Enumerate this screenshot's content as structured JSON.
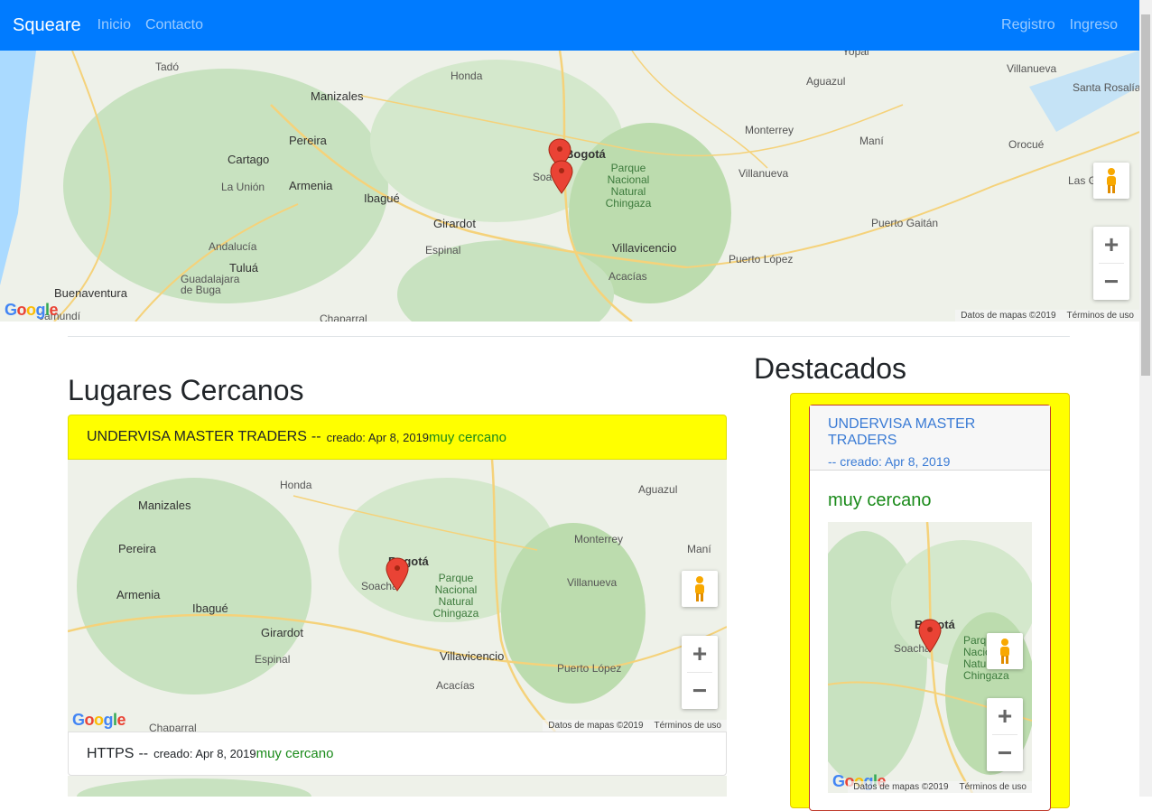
{
  "navbar": {
    "brand": "Squeare",
    "links": [
      "Inicio",
      "Contacto"
    ],
    "right_links": [
      "Registro",
      "Ingreso"
    ],
    "background": "#007bff"
  },
  "map_common": {
    "attribution": "Datos de mapas ©2019",
    "terms": "Términos de uso",
    "logo": "Google",
    "zoom_in": "+",
    "zoom_out": "−"
  },
  "top_map": {
    "places": [
      "Tadó",
      "Honda",
      "Manizales",
      "Pereira",
      "Cartago",
      "La Unión",
      "Armenia",
      "Ibagué",
      "Girardot",
      "Espinal",
      "Andalucía",
      "Tuluá",
      "Guadalajara de Buga",
      "Buenaventura",
      "Bogotá",
      "Soacha",
      "Parque Nacional Natural Chingaza",
      "Villavicencio",
      "Acacías",
      "Monterrey",
      "Villanueva",
      "Maní",
      "Orocué",
      "Puerto Gaitán",
      "Puerto López",
      "Santa Rosalía",
      "Aguazul",
      "Villanueva",
      "Yopal",
      "Las G",
      "Chaparral",
      "Jamundí"
    ]
  },
  "sections": {
    "nearby_title": "Lugares Cercanos",
    "featured_title": "Destacados"
  },
  "nearby": [
    {
      "name": "UNDERVISA MASTER TRADERS",
      "sep": "--",
      "created": "creado: Apr 8, 2019",
      "distance": "muy cercano"
    },
    {
      "name": "HTTPS",
      "sep": "--",
      "created": "creado: Apr 8, 2019",
      "distance": "muy cercano"
    }
  ],
  "featured": {
    "name": "UNDERVISA MASTER TRADERS",
    "created": "-- creado: Apr 8, 2019",
    "distance": "muy cercano"
  },
  "colors": {
    "highlight": "#ffff00",
    "near": "#1a8a1a",
    "link": "#3a7bd5"
  }
}
